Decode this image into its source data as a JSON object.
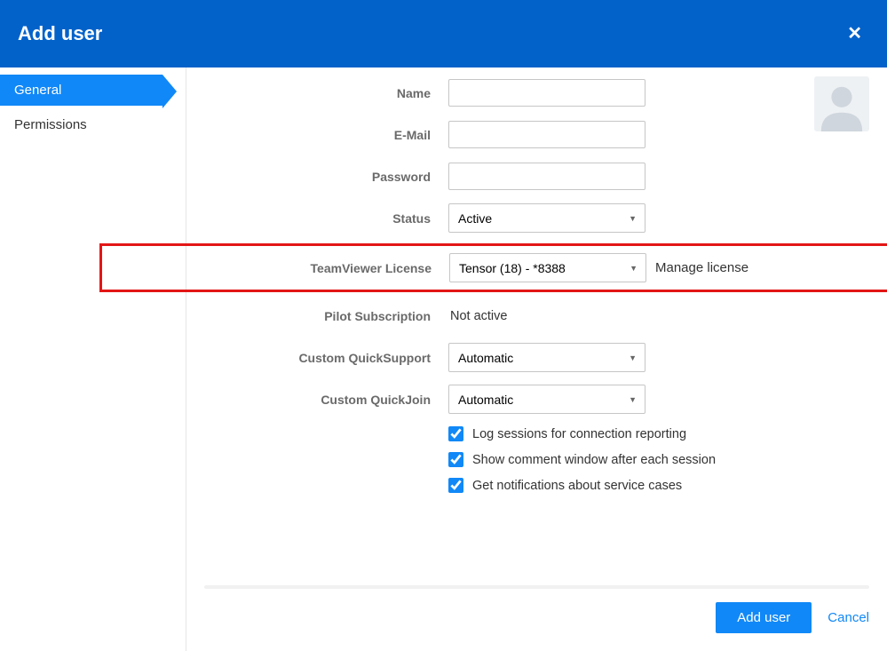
{
  "header": {
    "title": "Add user"
  },
  "sidebar": {
    "tabs": [
      {
        "label": "General",
        "active": true
      },
      {
        "label": "Permissions",
        "active": false
      }
    ]
  },
  "form": {
    "name": {
      "label": "Name",
      "value": ""
    },
    "email": {
      "label": "E-Mail",
      "value": ""
    },
    "password": {
      "label": "Password",
      "value": ""
    },
    "status": {
      "label": "Status",
      "value": "Active"
    },
    "license": {
      "label": "TeamViewer License",
      "value": "Tensor (18) - *8388",
      "manage": "Manage license"
    },
    "pilot": {
      "label": "Pilot Subscription",
      "value": "Not active"
    },
    "quicksupport": {
      "label": "Custom QuickSupport",
      "value": "Automatic"
    },
    "quickjoin": {
      "label": "Custom QuickJoin",
      "value": "Automatic"
    },
    "checks": {
      "log_sessions": {
        "label": "Log sessions for connection reporting",
        "checked": true
      },
      "show_comment": {
        "label": "Show comment window after each session",
        "checked": true
      },
      "notifications": {
        "label": "Get notifications about service cases",
        "checked": true
      }
    }
  },
  "footer": {
    "primary": "Add user",
    "cancel": "Cancel"
  }
}
